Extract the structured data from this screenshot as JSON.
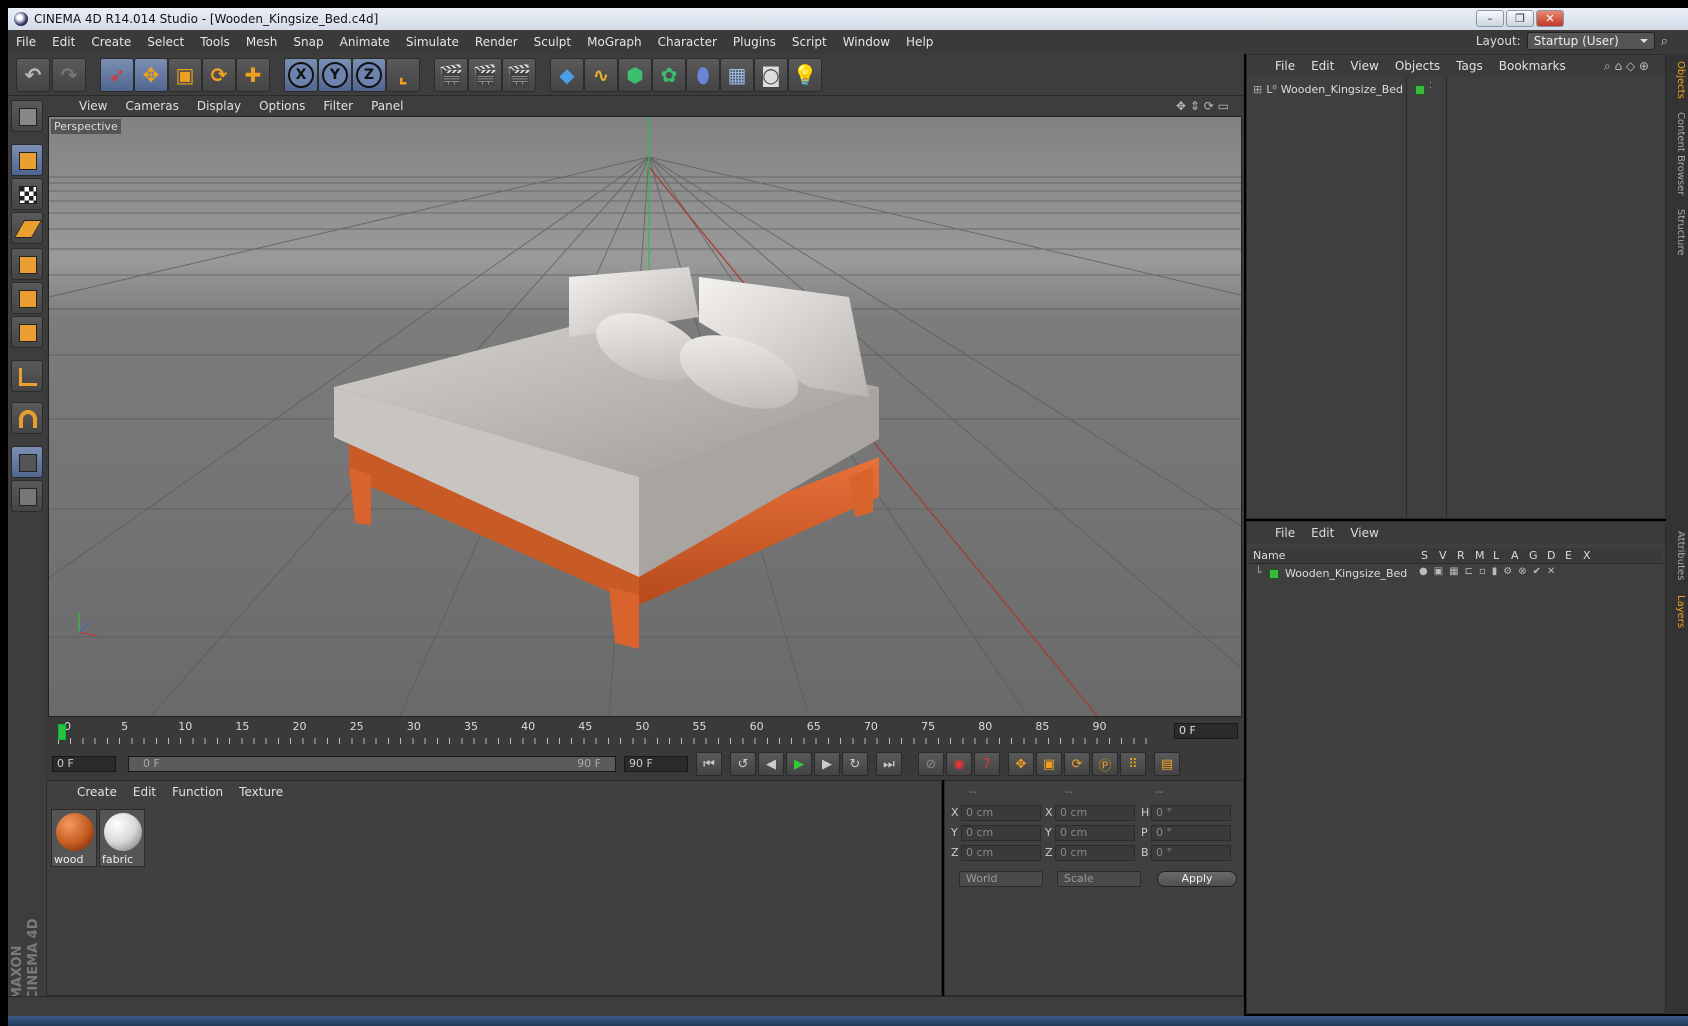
{
  "window": {
    "title": "CINEMA 4D R14.014 Studio - [Wooden_Kingsize_Bed.c4d]"
  },
  "menubar": {
    "items": [
      "File",
      "Edit",
      "Create",
      "Select",
      "Tools",
      "Mesh",
      "Snap",
      "Animate",
      "Simulate",
      "Render",
      "Sculpt",
      "MoGraph",
      "Character",
      "Plugins",
      "Script",
      "Window",
      "Help"
    ],
    "layout_label": "Layout:",
    "layout_value": "Startup (User)"
  },
  "toolbar": {
    "axis_x": "X",
    "axis_y": "Y",
    "axis_z": "Z"
  },
  "viewport": {
    "menu": [
      "View",
      "Cameras",
      "Display",
      "Options",
      "Filter",
      "Panel"
    ],
    "label": "Perspective"
  },
  "timeline": {
    "ticks": [
      "0",
      "5",
      "10",
      "15",
      "20",
      "25",
      "30",
      "35",
      "40",
      "45",
      "50",
      "55",
      "60",
      "65",
      "70",
      "75",
      "80",
      "85",
      "90"
    ],
    "current_frame": "0 F",
    "start_field": "0 F",
    "range_start": "0 F",
    "range_end": "90 F",
    "end_field": "90 F"
  },
  "materials": {
    "menu": [
      "Create",
      "Edit",
      "Function",
      "Texture"
    ],
    "items": [
      {
        "name": "wood",
        "color": "#c45a1e"
      },
      {
        "name": "fabric",
        "color": "#d8d8d8"
      }
    ]
  },
  "coords": {
    "headers": [
      "--",
      "--",
      "--"
    ],
    "rows": [
      {
        "a": "X",
        "b": "X",
        "c": "H",
        "v1": "0 cm",
        "v2": "0 cm",
        "v3": "0 °"
      },
      {
        "a": "Y",
        "b": "Y",
        "c": "P",
        "v1": "0 cm",
        "v2": "0 cm",
        "v3": "0 °"
      },
      {
        "a": "Z",
        "b": "Z",
        "c": "B",
        "v1": "0 cm",
        "v2": "0 cm",
        "v3": "0 °"
      }
    ],
    "world": "World",
    "scale": "Scale",
    "apply": "Apply"
  },
  "objects": {
    "menu": [
      "File",
      "Edit",
      "View",
      "Objects",
      "Tags",
      "Bookmarks"
    ],
    "item": "Wooden_Kingsize_Bed"
  },
  "layers": {
    "menu": [
      "File",
      "Edit",
      "View"
    ],
    "name_header": "Name",
    "cols": [
      "S",
      "V",
      "R",
      "M",
      "L",
      "A",
      "G",
      "D",
      "E",
      "X"
    ],
    "item": "Wooden_Kingsize_Bed"
  },
  "side_tabs": [
    "Objects",
    "Content Browser",
    "Structure",
    "Attributes",
    "Layers"
  ],
  "logo": {
    "line1": "MAXON",
    "line2": "CINEMA 4D"
  },
  "colors": {
    "accent_orange": "#f0a020",
    "selection_blue": "#6d83ad",
    "layer_green": "#3cb83c"
  }
}
